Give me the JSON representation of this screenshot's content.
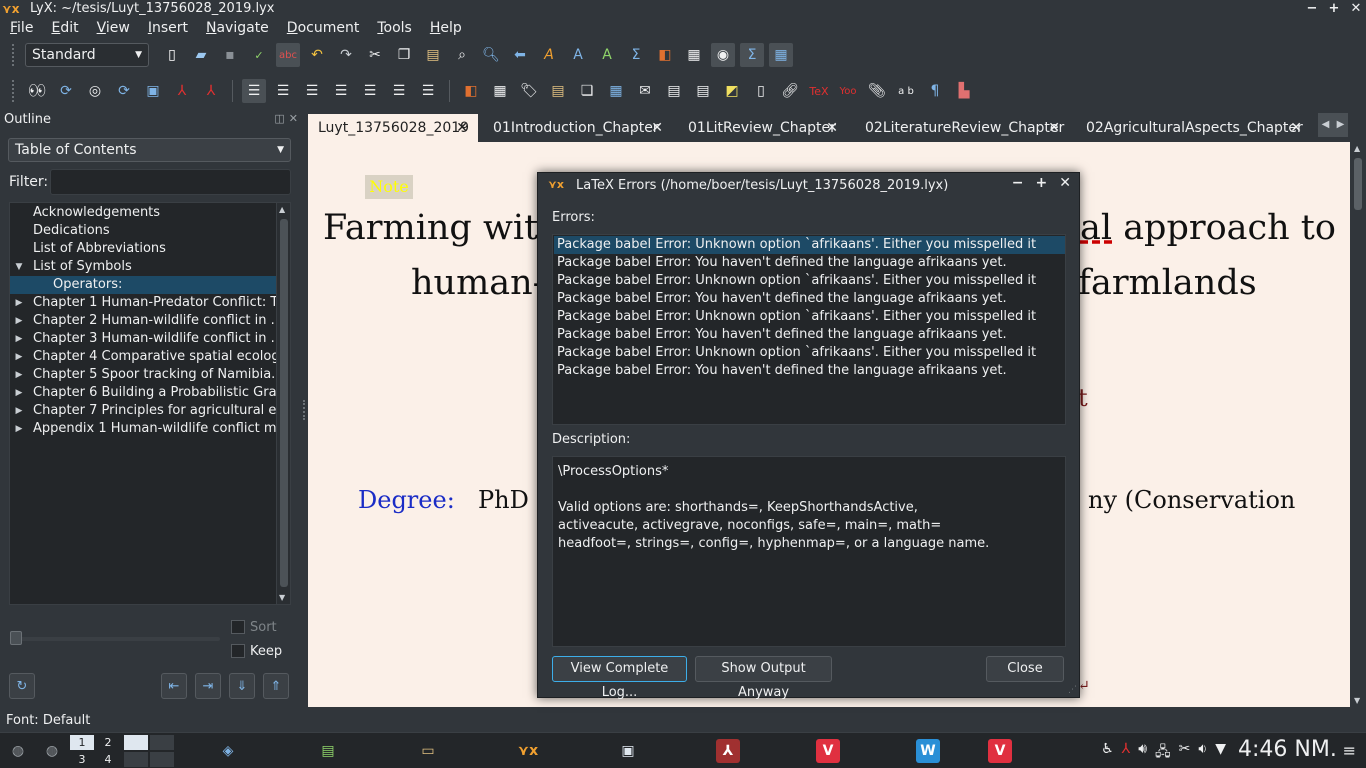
{
  "window": {
    "title": "LyX: ~/tesis/Luyt_13756028_2019.lyx"
  },
  "menu": [
    "File",
    "Edit",
    "View",
    "Insert",
    "Navigate",
    "Document",
    "Tools",
    "Help"
  ],
  "toolbar": {
    "layout_combo": "Standard"
  },
  "outline": {
    "title": "Outline",
    "combo": "Table of Contents",
    "filter_label": "Filter:",
    "items": [
      {
        "label": "Acknowledgements"
      },
      {
        "label": "Dedications"
      },
      {
        "label": "List of Abbreviations"
      },
      {
        "label": "List of Symbols"
      },
      {
        "label": "Operators:"
      },
      {
        "label": "Chapter 1 Human-Predator Conflict: T..."
      },
      {
        "label": "Chapter 2 Human-wildlife conflict in ..."
      },
      {
        "label": "Chapter 3 Human-wildlife conflict in ..."
      },
      {
        "label": "Chapter 4 Comparative spatial ecolog..."
      },
      {
        "label": "Chapter 5 Spoor tracking of Namibia..."
      },
      {
        "label": "Chapter 6 Building a Probabilistic Gra..."
      },
      {
        "label": "Chapter 7 Principles for agricultural e..."
      },
      {
        "label": "Appendix 1 Human-wildlife conflict m..."
      }
    ],
    "sort_label": "Sort",
    "keep_label": "Keep"
  },
  "tabs": [
    {
      "label": "Luyt_13756028_2019"
    },
    {
      "label": "01Introduction_Chapter"
    },
    {
      "label": "01LitReview_Chapter"
    },
    {
      "label": "02LiteratureReview_Chapter"
    },
    {
      "label": "02AgriculturalAspects_Chapter"
    }
  ],
  "document": {
    "note": "Note",
    "title_left_1": "Farming wit",
    "title_right_1a": "al",
    "title_right_1b": " approach to",
    "title_left_2": "human-",
    "title_right_2": "farmlands",
    "frag_t": "t",
    "degree_label": "Degree:",
    "degree_value": "PhD",
    "degree_tail": "ny (Conservation"
  },
  "status": "Font: Default",
  "dialog": {
    "title": "LaTeX Errors (/home/boer/tesis/Luyt_13756028_2019.lyx)",
    "errors_label": "Errors:",
    "errors": [
      "Package babel Error: Unknown option `afrikaans'. Either you misspelled it",
      "Package babel Error: You haven't defined the language afrikaans yet.",
      "Package babel Error: Unknown option `afrikaans'. Either you misspelled it",
      "Package babel Error: You haven't defined the language afrikaans yet.",
      "Package babel Error: Unknown option `afrikaans'. Either you misspelled it",
      "Package babel Error: You haven't defined the language afrikaans yet.",
      "Package babel Error: Unknown option `afrikaans'. Either you misspelled it",
      "Package babel Error: You haven't defined the language afrikaans yet."
    ],
    "description_label": "Description:",
    "description_lines": [
      " \\ProcessOptions*",
      "",
      "Valid options are: shorthands=, KeepShorthandsActive,",
      "activeacute, activegrave, noconfigs, safe=, main=, math=",
      "headfoot=, strings=, config=, hyphenmap=, or a language name."
    ],
    "btn_log": "View Complete Log...",
    "btn_show": "Show Output Anyway",
    "btn_close": "Close"
  },
  "taskbar": {
    "pager": [
      "1",
      "2",
      "3",
      "4"
    ],
    "clock": "4:46 NM."
  }
}
